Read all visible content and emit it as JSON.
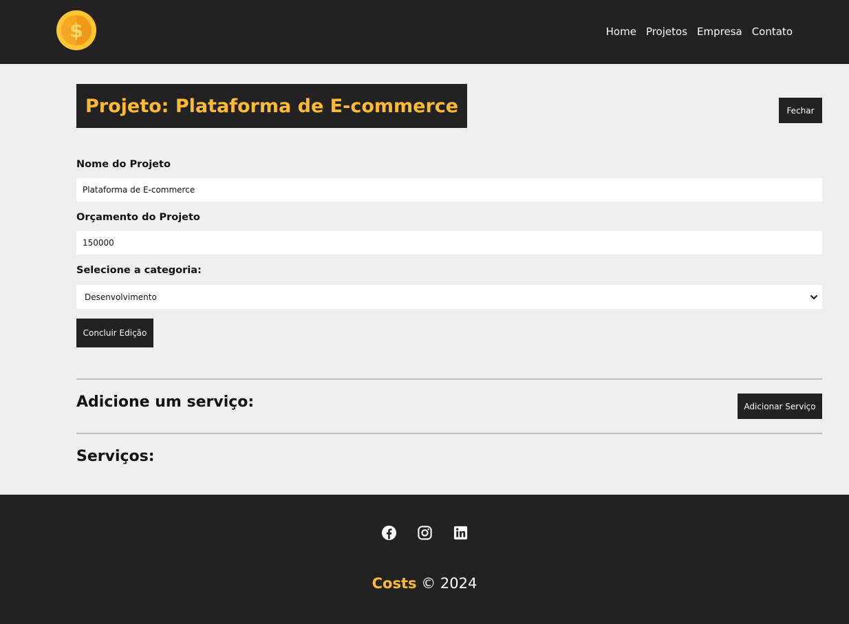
{
  "navbar": {
    "logo_icon": "coin-dollar-icon",
    "links": [
      "Home",
      "Projetos",
      "Empresa",
      "Contato"
    ]
  },
  "project": {
    "title": "Projeto: Plataforma de E-commerce",
    "close_label": "Fechar"
  },
  "form": {
    "name_label": "Nome do Projeto",
    "name_value": "Plataforma de E-commerce",
    "budget_label": "Orçamento do Projeto",
    "budget_value": "150000",
    "category_label": "Selecione a categoria:",
    "category_selected": "Desenvolvimento",
    "submit_label": "Concluir Edição"
  },
  "services": {
    "add_title": "Adicione um serviço:",
    "add_button": "Adicionar Serviço",
    "list_title": "Serviços:"
  },
  "footer": {
    "social_icons": [
      "facebook-icon",
      "instagram-icon",
      "linkedin-icon"
    ],
    "brand": "Costs",
    "copyright": "© 2024"
  },
  "colors": {
    "dark": "#222222",
    "accent": "#ffbb33",
    "background": "#efefef"
  }
}
